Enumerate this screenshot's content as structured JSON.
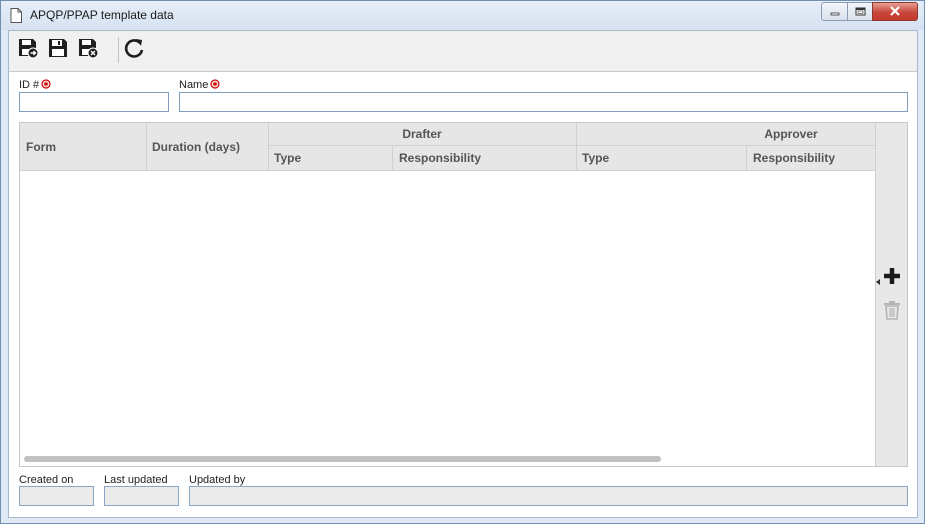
{
  "window": {
    "title": "APQP/PPAP template data",
    "controls": [
      "minimize",
      "maximize",
      "close"
    ]
  },
  "toolbar": {
    "buttons": [
      {
        "name": "save-and-new-icon"
      },
      {
        "name": "save-icon"
      },
      {
        "name": "save-and-close-icon"
      },
      {
        "name": "refresh-icon"
      }
    ]
  },
  "form": {
    "id_label": "ID #",
    "id_value": "",
    "name_label": "Name",
    "name_value": "",
    "required_color": "#cc0000"
  },
  "grid": {
    "columns": {
      "form": "Form",
      "duration": "Duration (days)",
      "drafter_group": "Drafter",
      "drafter_type": "Type",
      "drafter_responsibility": "Responsibility",
      "approver_group": "Approver",
      "approver_type": "Type",
      "approver_responsibility": "Responsibility"
    },
    "rows": [],
    "side_actions": [
      {
        "name": "add-icon"
      },
      {
        "name": "delete-icon",
        "disabled": true
      }
    ]
  },
  "footer": {
    "created_on_label": "Created on",
    "created_on_value": "",
    "last_updated_label": "Last updated",
    "last_updated_value": "",
    "updated_by_label": "Updated by",
    "updated_by_value": ""
  }
}
